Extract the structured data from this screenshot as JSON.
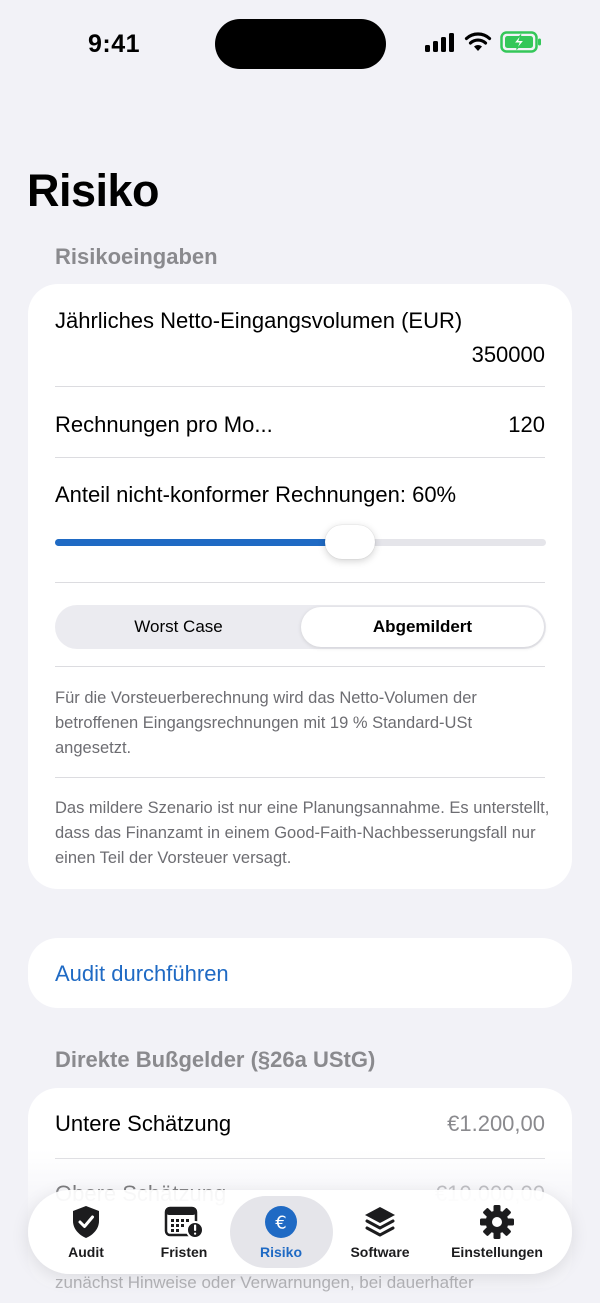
{
  "status_bar": {
    "time": "9:41"
  },
  "page": {
    "title": "Risiko"
  },
  "inputs_section": {
    "header": "Risikoeingaben",
    "annual_volume": {
      "label": "Jährliches Netto-Eingangsvolumen (EUR)",
      "value": "350000"
    },
    "invoices_per_month": {
      "label": "Rechnungen pro Mo...",
      "value": "120"
    },
    "noncompliant_share": {
      "label": "Anteil nicht-konformer Rechnungen: 60%",
      "value_fraction": 0.6
    },
    "scenario": {
      "options": [
        "Worst Case",
        "Abgemildert"
      ],
      "selected": "Abgemildert"
    },
    "note_1": "Für die Vorsteuerberechnung wird das Netto-Volumen der betroffenen Eingangsrechnungen mit 19 % Standard-USt angesetzt.",
    "note_2": "Das mildere Szenario ist nur eine Planungsannahme. Es unterstellt, dass das Finanzamt in einem Good-Faith-Nachbesserungsfall nur einen Teil der Vorsteuer versagt."
  },
  "audit_action": {
    "label": "Audit durchführen"
  },
  "fines_section": {
    "header": "Direkte Bußgelder (§26a UStG)",
    "lower_estimate": {
      "label": "Untere Schätzung",
      "value": "€1.200,00"
    },
    "upper_estimate_partial": {
      "label": "Obere Schätzung",
      "value": "€10.000,00"
    },
    "trailing_text": "zunächst Hinweise oder Verwarnungen, bei dauerhafter"
  },
  "tab_bar": {
    "selected": "Risiko",
    "tabs": [
      {
        "label": "Audit",
        "icon": "shield-check-icon"
      },
      {
        "label": "Fristen",
        "icon": "calendar-alert-icon"
      },
      {
        "label": "Risiko",
        "icon": "euro-circle-icon"
      },
      {
        "label": "Software",
        "icon": "layers-stack-icon"
      },
      {
        "label": "Einstellungen",
        "icon": "gear-icon"
      }
    ]
  },
  "colors": {
    "accent": "#1f6ac4",
    "background": "#f2f2f7",
    "battery": "#34c759"
  }
}
